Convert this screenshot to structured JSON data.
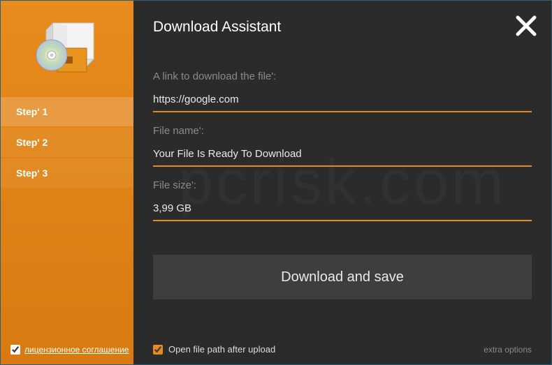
{
  "title": "Download Assistant",
  "sidebar": {
    "steps": [
      {
        "label": "Step' 1",
        "active": true
      },
      {
        "label": "Step' 2",
        "active": false
      },
      {
        "label": "Step' 3",
        "active": false
      }
    ],
    "license_checked": true,
    "license_label": "лицензионное соглашение"
  },
  "form": {
    "link_label": "A link to download the file':",
    "link_value": "https://google.com",
    "name_label": "File name':",
    "name_value": "Your File Is Ready To Download",
    "size_label": "File size':",
    "size_value": "3,99 GB"
  },
  "download_button": "Download and save",
  "open_path_checked": true,
  "open_path_label": "Open file path after upload",
  "extra_label": "extra options"
}
